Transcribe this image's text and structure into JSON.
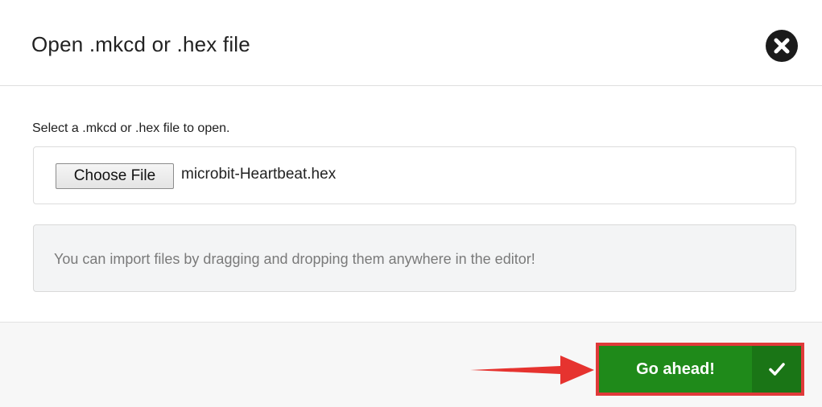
{
  "dialog": {
    "title": "Open .mkcd or .hex file",
    "close_icon": "close-circle-icon"
  },
  "form": {
    "label": "Select a .mkcd or .hex file to open.",
    "choose_button_label": "Choose File",
    "selected_file": "microbit-Heartbeat.hex"
  },
  "info": {
    "text": "You can import files by dragging and dropping them anywhere in the editor!"
  },
  "footer": {
    "go_button_label": "Go ahead!",
    "go_button_icon": "checkmark-icon",
    "annotation": "red-arrow-annotation"
  },
  "colors": {
    "primary_green": "#1f8a1a",
    "primary_green_dark": "#1a7516",
    "highlight_red": "#e03a3a",
    "info_bg": "#f3f4f5"
  }
}
